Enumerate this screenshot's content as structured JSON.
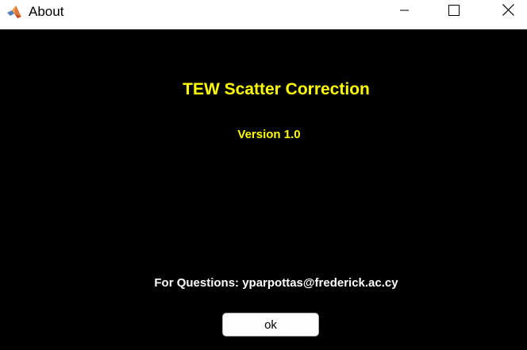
{
  "window": {
    "title": "About",
    "app_icon": "matlab-logo-icon",
    "controls": [
      "minimize-icon",
      "maximize-icon",
      "close-icon"
    ]
  },
  "dialog": {
    "heading": "TEW Scatter Correction",
    "version": "Version 1.0",
    "contact": "For Questions: yparpottas@frederick.ac.cy",
    "ok_label": "ok"
  },
  "colors": {
    "background": "#000000",
    "heading": "#ffff00",
    "version": "#ffff00",
    "contact": "#ffffff"
  }
}
